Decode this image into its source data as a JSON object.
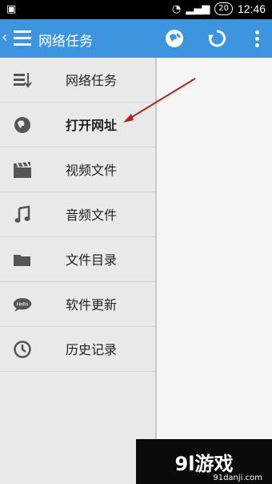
{
  "status": {
    "badge": "20",
    "time": "12:46"
  },
  "appbar": {
    "title": "网络任务"
  },
  "drawer": {
    "items": [
      {
        "label": "网络任务"
      },
      {
        "label": "打开网址"
      },
      {
        "label": "视频文件"
      },
      {
        "label": "音频文件"
      },
      {
        "label": "文件目录"
      },
      {
        "label": "软件更新"
      },
      {
        "label": "历史记录"
      }
    ]
  },
  "watermark": {
    "title": "9l游戏",
    "subtitle": "91danji.com"
  },
  "colors": {
    "appbar": "#3d95e0",
    "arrow": "#b22222"
  }
}
